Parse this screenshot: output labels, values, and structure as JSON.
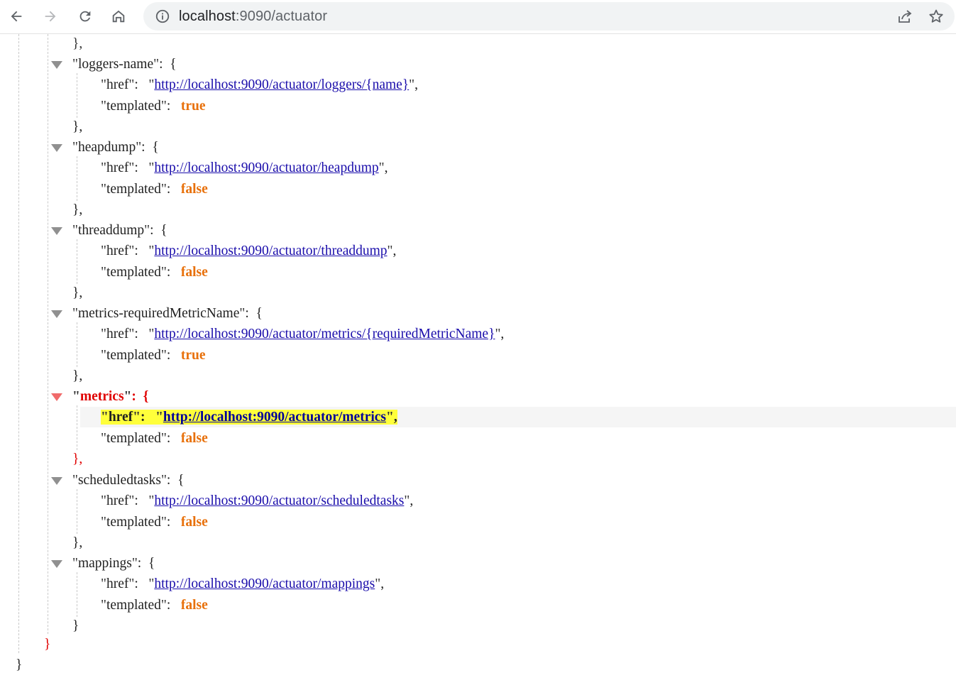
{
  "browser": {
    "url_host": "localhost",
    "url_path": ":9090/actuator"
  },
  "json": {
    "top_close": "},",
    "entries": [
      {
        "key": "loggers-name",
        "href": "http://localhost:9090/actuator/loggers/{name}",
        "templated": "true",
        "close": "},",
        "active": false
      },
      {
        "key": "heapdump",
        "href": "http://localhost:9090/actuator/heapdump",
        "templated": "false",
        "close": "},",
        "active": false
      },
      {
        "key": "threaddump",
        "href": "http://localhost:9090/actuator/threaddump",
        "templated": "false",
        "close": "},",
        "active": false
      },
      {
        "key": "metrics-requiredMetricName",
        "href": "http://localhost:9090/actuator/metrics/{requiredMetricName}",
        "templated": "true",
        "close": "},",
        "active": false
      },
      {
        "key": "metrics",
        "href": "http://localhost:9090/actuator/metrics",
        "templated": "false",
        "close": "},",
        "active": true
      },
      {
        "key": "scheduledtasks",
        "href": "http://localhost:9090/actuator/scheduledtasks",
        "templated": "false",
        "close": "},",
        "active": false
      },
      {
        "key": "mappings",
        "href": "http://localhost:9090/actuator/mappings",
        "templated": "false",
        "close": "}",
        "active": false
      }
    ],
    "links_close": "}",
    "root_close": "}",
    "href_key": "href",
    "templated_key": "templated"
  },
  "colors": {
    "boolean": "#e8700a",
    "link": "#1a0dab",
    "active": "#e00000",
    "highlight": "#ffff3b"
  }
}
